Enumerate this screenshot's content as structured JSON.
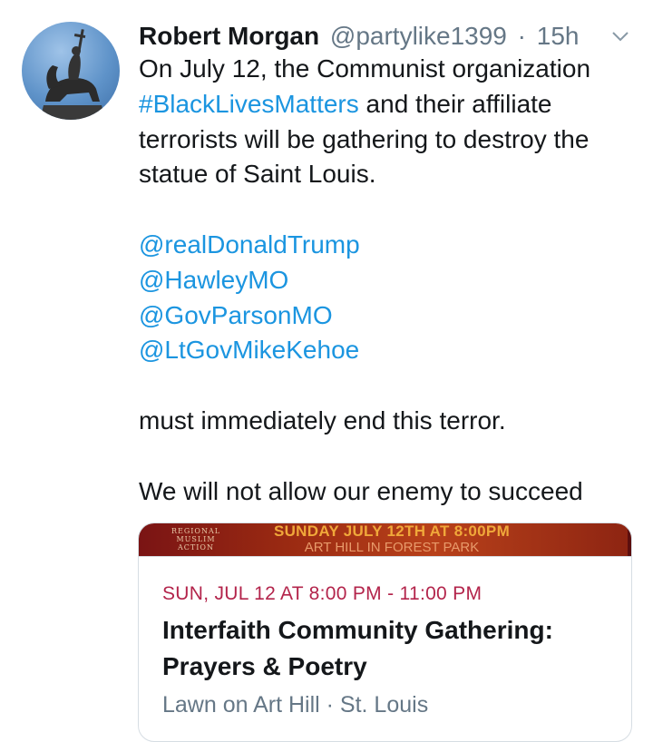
{
  "tweet": {
    "author_name": "Robert Morgan",
    "author_handle": "@partylike1399",
    "separator": "·",
    "time": "15h",
    "text_line1_a": "On July 12, the Communist organization",
    "hashtag": "#BlackLivesMatters",
    "text_line2_b": " and their affiliate",
    "text_line3": "terrorists will be gathering to destroy the",
    "text_line4": "statue of Saint Louis.",
    "mentions": [
      "@realDonaldTrump",
      "@HawleyMO",
      "@GovParsonMO",
      "@LtGovMikeKehoe"
    ],
    "text_end1": "must immediately end this terror.",
    "text_end2": "We will not allow our enemy to succeed"
  },
  "card": {
    "banner_logo": "REGIONAL MUSLIM ACTION",
    "banner_title": "SUNDAY JULY 12TH AT 8:00PM",
    "banner_sub": "ART HILL IN FOREST PARK",
    "date": "SUN, JUL 12 AT 8:00 PM - 11:00 PM",
    "title": "Interfaith Community Gathering: Prayers & Poetry",
    "location": "Lawn on Art Hill · St. Louis"
  },
  "icons": {
    "avatar": "statue-avatar",
    "caret": "chevron-down-icon"
  },
  "colors": {
    "link": "#1b95e0",
    "muted": "#657786",
    "event_date": "#b3244b"
  }
}
